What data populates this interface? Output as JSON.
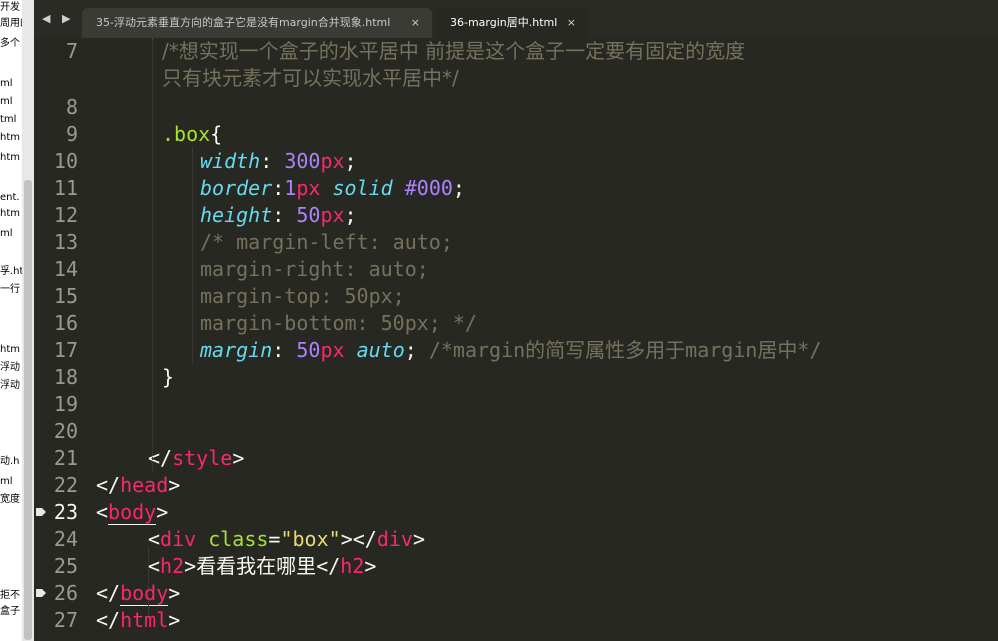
{
  "left_fragments": [
    "开发",
    "周用的",
    "多个",
    "ml",
    "ml",
    "tml",
    "htm",
    "htm",
    "ent.",
    "htm",
    "ml",
    "孚.ht",
    "一行",
    "htm",
    "浮动",
    "浮动",
    "动.h",
    "ml",
    "宽度",
    "拒不",
    "盒子"
  ],
  "tabs": {
    "nav_arrows": "◀ ▶",
    "inactive_label": "35-浮动元素垂直方向的盒子它是没有margin合并现象.html",
    "active_label": "36-margin居中.html",
    "close_glyph": "×"
  },
  "editor": {
    "lines": [
      {
        "num": "7",
        "segments": [
          {
            "t": "/*想实现一个盒子的水平居中 前提是这个盒子一定要有固定的宽度",
            "c": "c cn"
          }
        ],
        "indent": 1
      },
      {
        "num": "",
        "segments": [
          {
            "t": "只有块元素才可以实现水平居中*/",
            "c": "c cn"
          }
        ],
        "indent": 1
      },
      {
        "num": "8",
        "segments": [],
        "indent": 0
      },
      {
        "num": "9",
        "segments": [
          {
            "t": ".box",
            "c": "v"
          },
          {
            "t": "{",
            "c": "p"
          }
        ],
        "indent": 1
      },
      {
        "num": "10",
        "segments": [
          {
            "t": "width",
            "c": "k"
          },
          {
            "t": ": ",
            "c": "p"
          },
          {
            "t": "300",
            "c": "n"
          },
          {
            "t": "px",
            "c": "u"
          },
          {
            "t": ";",
            "c": "p"
          }
        ],
        "indent": 2
      },
      {
        "num": "11",
        "segments": [
          {
            "t": "border",
            "c": "k"
          },
          {
            "t": ":",
            "c": "p"
          },
          {
            "t": "1",
            "c": "n"
          },
          {
            "t": "px",
            "c": "u"
          },
          {
            "t": " solid ",
            "c": "k"
          },
          {
            "t": "#000",
            "c": "n"
          },
          {
            "t": ";",
            "c": "p"
          }
        ],
        "indent": 2
      },
      {
        "num": "12",
        "segments": [
          {
            "t": "height",
            "c": "k"
          },
          {
            "t": ": ",
            "c": "p"
          },
          {
            "t": "50",
            "c": "n"
          },
          {
            "t": "px",
            "c": "u"
          },
          {
            "t": ";",
            "c": "p"
          }
        ],
        "indent": 2
      },
      {
        "num": "13",
        "segments": [
          {
            "t": "/* margin-left: auto;",
            "c": "c"
          }
        ],
        "indent": 2
      },
      {
        "num": "14",
        "segments": [
          {
            "t": "margin-right: auto;",
            "c": "c"
          }
        ],
        "indent": 2
      },
      {
        "num": "15",
        "segments": [
          {
            "t": "margin-top: 50px;",
            "c": "c"
          }
        ],
        "indent": 2
      },
      {
        "num": "16",
        "segments": [
          {
            "t": "margin-bottom: 50px; */",
            "c": "c"
          }
        ],
        "indent": 2
      },
      {
        "num": "17",
        "segments": [
          {
            "t": "margin",
            "c": "k"
          },
          {
            "t": ": ",
            "c": "p"
          },
          {
            "t": "50",
            "c": "n"
          },
          {
            "t": "px",
            "c": "u"
          },
          {
            "t": " auto",
            "c": "k"
          },
          {
            "t": "; ",
            "c": "p"
          },
          {
            "t": "/*margin的简写属性多用于margin居中*/",
            "c": "c"
          }
        ],
        "indent": 2
      },
      {
        "num": "18",
        "segments": [
          {
            "t": "}",
            "c": "p"
          }
        ],
        "indent": 1
      },
      {
        "num": "19",
        "segments": [],
        "indent": 0
      },
      {
        "num": "20",
        "segments": [],
        "indent": 0
      },
      {
        "num": "21",
        "segments": [
          {
            "t": "</",
            "c": "p"
          },
          {
            "t": "style",
            "c": "t"
          },
          {
            "t": ">",
            "c": "p"
          }
        ],
        "indent": -1
      },
      {
        "num": "22",
        "segments": [
          {
            "t": "</",
            "c": "p"
          },
          {
            "t": "head",
            "c": "t"
          },
          {
            "t": ">",
            "c": "p"
          }
        ],
        "indent": 0
      },
      {
        "num": "23",
        "segments": [
          {
            "t": "<",
            "c": "p"
          },
          {
            "t": "body",
            "c": "t ul"
          },
          {
            "t": ">",
            "c": "p"
          }
        ],
        "indent": 0,
        "current": true,
        "bookmark": true
      },
      {
        "num": "24",
        "segments": [
          {
            "t": "<",
            "c": "p"
          },
          {
            "t": "div",
            "c": "t"
          },
          {
            "t": " class",
            "c": "v"
          },
          {
            "t": "=",
            "c": "p"
          },
          {
            "t": "\"box\"",
            "c": "s"
          },
          {
            "t": "></",
            "c": "p"
          },
          {
            "t": "div",
            "c": "t"
          },
          {
            "t": ">",
            "c": "p"
          }
        ],
        "indent": -1
      },
      {
        "num": "25",
        "segments": [
          {
            "t": "<",
            "c": "p"
          },
          {
            "t": "h2",
            "c": "t"
          },
          {
            "t": ">",
            "c": "p"
          },
          {
            "t": "看看我在哪里",
            "c": "p cn"
          },
          {
            "t": "</",
            "c": "p"
          },
          {
            "t": "h2",
            "c": "t"
          },
          {
            "t": ">",
            "c": "p"
          }
        ],
        "indent": -1
      },
      {
        "num": "26",
        "segments": [
          {
            "t": "</",
            "c": "p"
          },
          {
            "t": "body",
            "c": "t ul"
          },
          {
            "t": ">",
            "c": "p"
          }
        ],
        "indent": 0,
        "bookmark": true
      },
      {
        "num": "27",
        "segments": [
          {
            "t": "</",
            "c": "p"
          },
          {
            "t": "html",
            "c": "t"
          },
          {
            "t": ">",
            "c": "p"
          }
        ],
        "indent": 0
      }
    ]
  }
}
